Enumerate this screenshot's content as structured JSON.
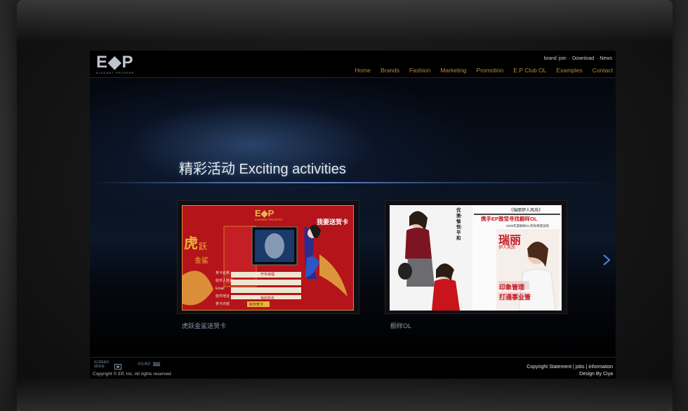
{
  "header": {
    "logo_text": "E◆P",
    "logo_sub": "ELEGANT PROSPER",
    "util_links": [
      "brand",
      "join",
      "·",
      "Download",
      "·",
      "News"
    ],
    "nav": [
      "Home",
      "Brands",
      "Fashion",
      "Marketing",
      "Promotion",
      "E.P Club OL",
      "Examples",
      "Contact"
    ]
  },
  "main": {
    "heading": "精彩活动 Exciting activities",
    "cards": [
      {
        "caption": "虎跃金鲨送贺卡",
        "logo": "E◆P",
        "logo_sub": "ELEGANT PROSPER",
        "banner": "我要送贺卡",
        "calligraphy_1": "虎",
        "calligraphy_2": "跃",
        "calligraphy_3": "金鲨",
        "form_labels": [
          "贺卡名称",
          "收件人姓名",
          "Email",
          "收件地址",
          "贺卡内容"
        ],
        "form_option": "开年纳福",
        "form_right_label": "我的姓名",
        "submit_label": "制作贺卡"
      },
      {
        "caption": "橱样OL",
        "vertical_text": "优雅·愉悦·平和",
        "mag_title": "《瑞丽伊人风尚》",
        "mag_line2": "携手EP雅莹寻找橱样OL",
        "mag_line3": "2009年度橱样OL等你来建议呢",
        "mag_brand": "瑞丽",
        "mag_brand_sub": "伊人风尚",
        "mag_head_1": "印象管理",
        "mag_head_2": "打通事业管"
      }
    ]
  },
  "footer": {
    "screen_mode": "SCREEN MODE",
    "sound": "SOUND",
    "copyright": "Copyright © EP, Inc. All rights reserved",
    "links": [
      "Copyright Statement",
      "|",
      "jobs",
      "|",
      "information"
    ],
    "design": "Design By Ciya"
  },
  "colors": {
    "nav": "#b08a3e",
    "card1_bg": "#b5141a",
    "accent_blue": "#5a8ad8"
  }
}
